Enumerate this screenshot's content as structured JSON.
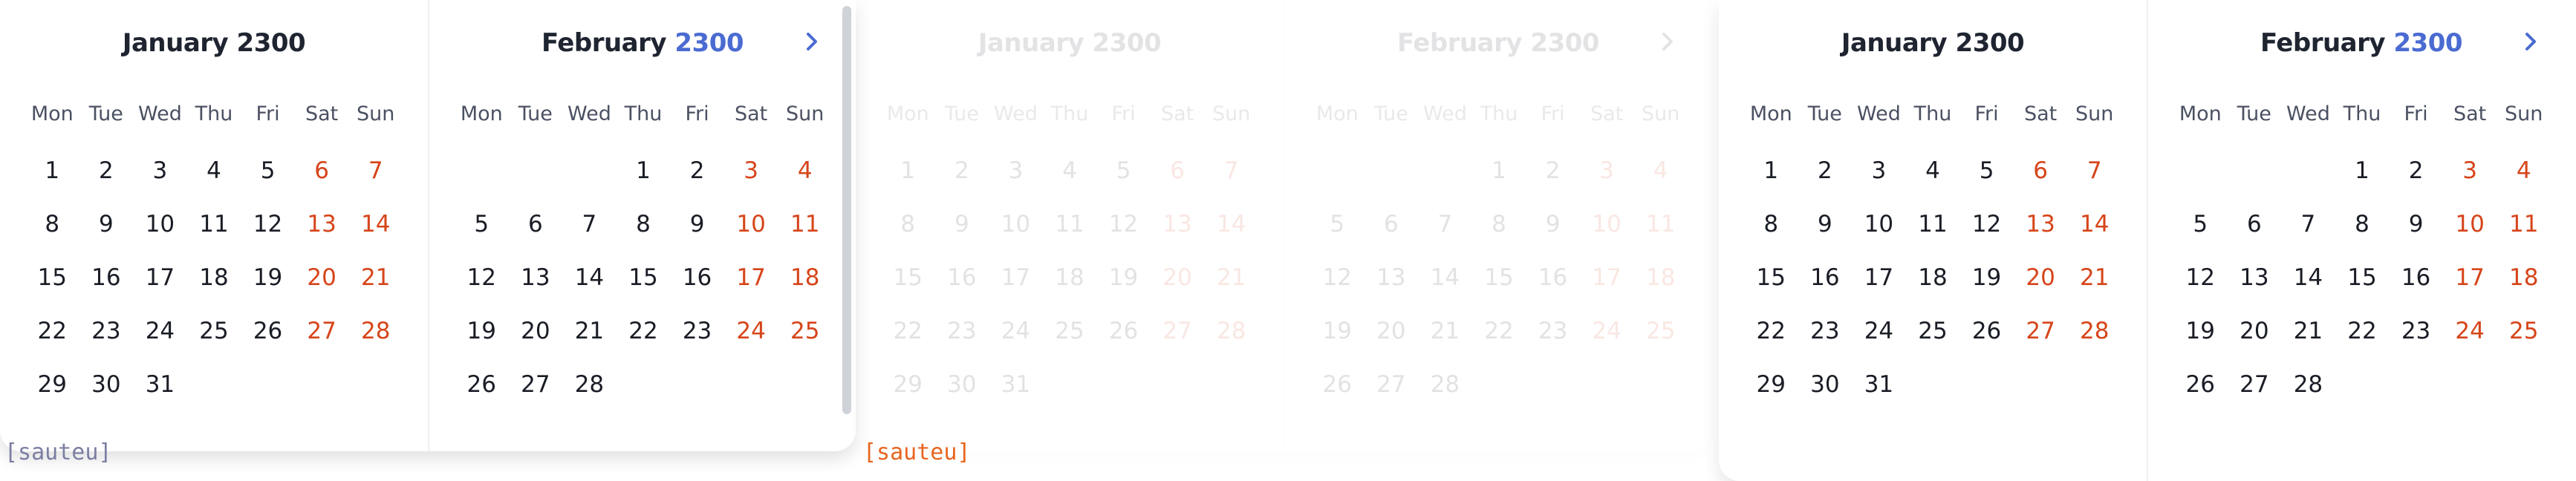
{
  "weekday_labels": [
    "Mon",
    "Tue",
    "Wed",
    "Thu",
    "Fri",
    "Sat",
    "Sun"
  ],
  "january": {
    "month": "January",
    "year": "2300",
    "days": [
      "1",
      "2",
      "3",
      "4",
      "5",
      "6",
      "7",
      "8",
      "9",
      "10",
      "11",
      "12",
      "13",
      "14",
      "15",
      "16",
      "17",
      "18",
      "19",
      "20",
      "21",
      "22",
      "23",
      "24",
      "25",
      "26",
      "27",
      "28",
      "29",
      "30",
      "31"
    ],
    "leading_blanks": 0
  },
  "february": {
    "month": "February",
    "year": "2300",
    "days": [
      "1",
      "2",
      "3",
      "4",
      "5",
      "6",
      "7",
      "8",
      "9",
      "10",
      "11",
      "12",
      "13",
      "14",
      "15",
      "16",
      "17",
      "18",
      "19",
      "20",
      "21",
      "22",
      "23",
      "24",
      "25",
      "26",
      "27",
      "28"
    ],
    "leading_blanks": 3
  },
  "next_icon": "chevron-right-icon",
  "colors": {
    "weekend": "#d6451a",
    "year_accent": "#4a6bd1",
    "text": "#1a1d26",
    "below_label_a": "#7b7fa3",
    "below_label_b": "#e8651f"
  },
  "below_labels": {
    "left": "[sauteu]",
    "middle": "[sauteu]"
  }
}
